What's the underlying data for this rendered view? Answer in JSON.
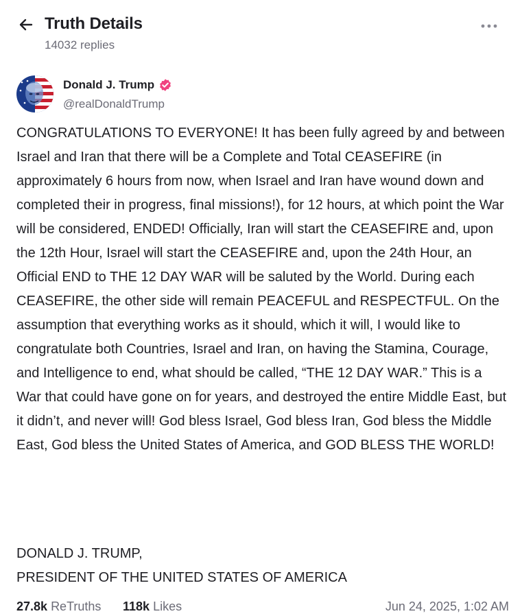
{
  "header": {
    "title": "Truth Details",
    "reply_count": "14032 replies",
    "back_icon": "arrow-left-icon",
    "more_icon": "more-horizontal-icon"
  },
  "post": {
    "author_name": "Donald J. Trump",
    "author_handle": "@realDonaldTrump",
    "verified_icon": "verified-badge-icon",
    "verified_color": "#f0427f",
    "body": "CONGRATULATIONS TO EVERYONE! It has been fully agreed by and between Israel and Iran that there will be a Complete and Total CEASEFIRE (in approximately 6 hours from now, when Israel and Iran have wound down and completed their in progress, final missions!), for 12 hours, at which point the War will be considered, ENDED! Officially, Iran will start the CEASEFIRE and, upon the 12th Hour, Israel will start the CEASEFIRE and, upon the 24th Hour, an Official END to THE 12 DAY WAR will be saluted by the World. During each CEASEFIRE, the other side will remain PEACEFUL and RESPECTFUL. On the assumption that everything works as it should, which it will, I would like to congratulate both Countries, Israel and Iran, on having the Stamina, Courage, and Intelligence to end, what should be called, “THE 12 DAY WAR.” This is a War that could have gone on for years, and destroyed the entire Middle East, but it didn’t, and never will! God bless Israel, God bless Iran, God bless the Middle East, God bless the United States of America, and GOD BLESS THE WORLD!",
    "signature_line1": "DONALD J. TRUMP,",
    "signature_line2": "PRESIDENT OF THE UNITED STATES OF AMERICA"
  },
  "stats": {
    "retruths_count": "27.8k",
    "retruths_label": "ReTruths",
    "likes_count": "118k",
    "likes_label": "Likes",
    "timestamp": "Jun 24, 2025, 1:02 AM"
  }
}
